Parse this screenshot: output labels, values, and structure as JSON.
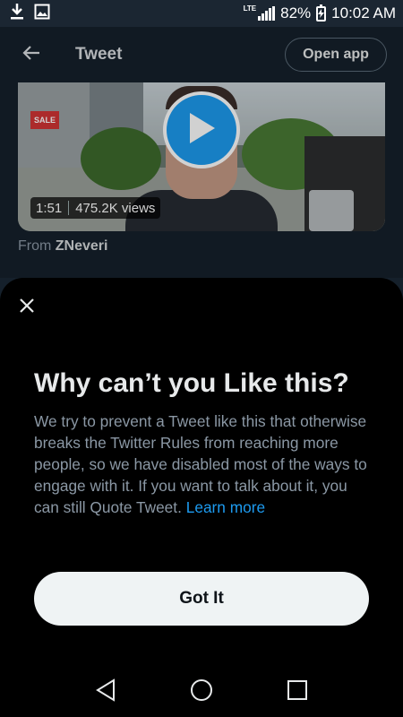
{
  "status_bar": {
    "network_label": "LTE",
    "battery_percent": "82%",
    "time": "10:02 AM",
    "icons": [
      "download-icon",
      "image-icon",
      "signal-icon",
      "battery-icon"
    ]
  },
  "header": {
    "title": "Tweet",
    "open_app_label": "Open app",
    "back_icon": "arrow-left-icon"
  },
  "video": {
    "duration": "1:51",
    "views": "475.2K views",
    "sign_text": "SALE"
  },
  "source": {
    "from_label": "From",
    "username": "ZNeveri"
  },
  "sheet": {
    "title": "Why can’t you Like this?",
    "body": "We try to prevent a Tweet like this that otherwise breaks the Twitter Rules from reaching more people, so we have disabled most of the ways to engage with it. If you want to talk about it, you can still Quote Tweet.",
    "link_label": "Learn more",
    "button_label": "Got It"
  },
  "nav_bar": {
    "icons": [
      "back-icon",
      "home-icon",
      "recents-icon"
    ]
  },
  "colors": {
    "accent": "#1d9bf0",
    "background": "#15202b",
    "sheet": "#000000"
  }
}
